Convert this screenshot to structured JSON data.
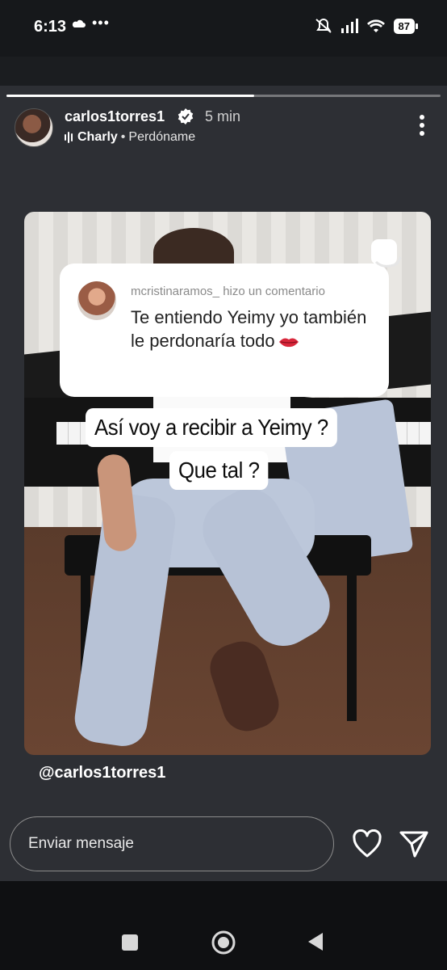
{
  "status_bar": {
    "time": "6:13",
    "dots": "•••",
    "battery": "87",
    "icons": [
      "cloud-icon",
      "mute-icon",
      "signal-icon",
      "wifi-icon",
      "battery-icon"
    ]
  },
  "story": {
    "progress_fraction": 0.57,
    "username": "carlos1torres1",
    "verified": true,
    "time_ago": "5 min",
    "music_artist": "Charly",
    "music_separator": "•",
    "music_song": "Perdóname"
  },
  "comment": {
    "author_meta": "mcristinaramos_ hizo un comentario",
    "text": "Te entiendo Yeimy yo también le perdonaría todo",
    "emoji": "lips-icon"
  },
  "captions": {
    "line1": "Así voy a recibir a Yeimy ?",
    "line2": "Que tal ?"
  },
  "mention": "@carlos1torres1",
  "reply": {
    "placeholder": "Enviar mensaje"
  },
  "colors": {
    "story_bg": "#2d2f34",
    "card_bg": "#ffffff",
    "verified_blue": "#ffffff"
  }
}
